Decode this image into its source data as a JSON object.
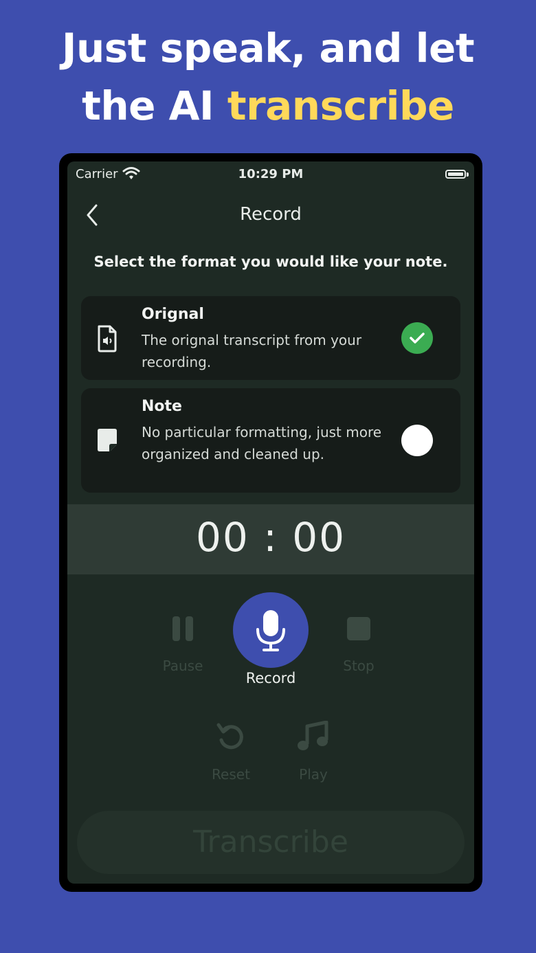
{
  "headline": {
    "line1": "Just speak, and let",
    "line2_prefix": "the AI ",
    "line2_accent": "transcribe"
  },
  "status_bar": {
    "carrier": "Carrier",
    "time": "10:29 PM"
  },
  "nav": {
    "title": "Record",
    "back_icon": "chevron-left-icon"
  },
  "prompt": "Select the format you would like your note.",
  "formats": [
    {
      "title": "Orignal",
      "description": "The orignal transcript from your recording.",
      "icon": "audio-file-icon",
      "selected": true
    },
    {
      "title": "Note",
      "description": "No particular formatting, just more organized and cleaned up.",
      "icon": "sticky-note-icon",
      "selected": false
    }
  ],
  "timer": "00 : 00",
  "controls": {
    "pause_label": "Pause",
    "record_label": "Record",
    "stop_label": "Stop",
    "reset_label": "Reset",
    "play_label": "Play"
  },
  "transcribe_label": "Transcribe",
  "colors": {
    "background": "#3e4eae",
    "accent_yellow": "#ffd95a",
    "check_green": "#3bac52",
    "record_button": "#3e4eae",
    "screen_bg": "#1e2a24"
  }
}
